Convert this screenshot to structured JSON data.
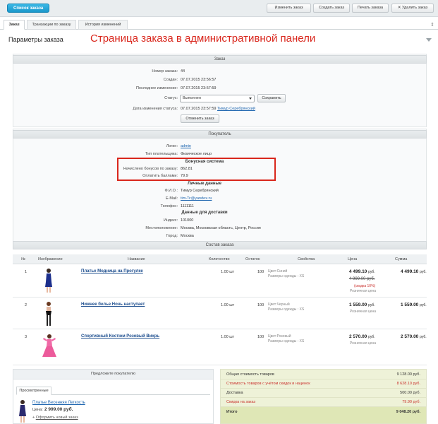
{
  "toolbar": {
    "order_list": "Список заказа",
    "edit": "Изменить заказ",
    "create": "Создать заказ",
    "print": "Печать заказа",
    "delete": "Удалить заказ"
  },
  "tabs": [
    "Заказ",
    "Транзакции по заказу",
    "История изменений"
  ],
  "header": {
    "title": "Параметры заказа",
    "caption": "Страница заказа в административной панели"
  },
  "order": {
    "bar": "Заказ",
    "number_label": "Номер заказа:",
    "number": "44",
    "created_label": "Создан:",
    "created": "07.07.2015 23:56:57",
    "modified_label": "Последнее изменение:",
    "modified": "07.07.2015 23:57:59",
    "status_label": "Статус:",
    "status_value": "Выполнен",
    "save": "Сохранить",
    "status_date_label": "Дата изменения статуса:",
    "status_date": "07.07.2015 23:57:59",
    "status_user": "Тимур Серебрянский",
    "cancel": "Отменить заказ"
  },
  "buyer": {
    "bar": "Покупатель",
    "login_label": "Логин:",
    "login": "admin",
    "payer_label": "Тип плательщика:",
    "payer": "Физическое лицо",
    "bonus_head": "Бонусная система",
    "bonus_label": "Начислено бонусов по заказу:",
    "bonus": "862.81",
    "paid_label": "Оплатить баллами:",
    "paid": "79.9",
    "personal_head": "Личные данные",
    "fio_label": "Ф.И.О.:",
    "fio": "Тимур Серебрянский",
    "email_label": "E-Mail:",
    "email": "tim-Tc@yandex.ru",
    "phone_label": "Телефон:",
    "phone": "1111111",
    "delivery_head": "Данные для доставки",
    "index_label": "Индекс:",
    "index": "101000",
    "location_label": "Местоположение:",
    "location": "Москва, Московская область, Центр, Россия",
    "city_label": "Город:",
    "city": "Москва"
  },
  "composition": {
    "bar": "Состав заказа",
    "columns": [
      "№",
      "Изображение",
      "Название",
      "Количество",
      "Остаток",
      "Свойства",
      "Цена",
      "Сумма"
    ],
    "items": [
      {
        "n": "1",
        "name": "Платье Модница на Прогулке",
        "qty": "1.00 шт",
        "stock": "100",
        "prop1": "Цвет:Синий",
        "prop2": "Размеры одежды : XS",
        "price": "4 499.10",
        "old": "4 999.00",
        "disc": "(скидка 10%)",
        "note": "Розничная цена",
        "sum": "4 499.10"
      },
      {
        "n": "2",
        "name": "Нижнее белье Ночь наступает",
        "qty": "1.00 шт",
        "stock": "100",
        "prop1": "Цвет:Черный",
        "prop2": "Размеры одежды : XS",
        "price": "1 559.00",
        "old": "",
        "disc": "",
        "note": "Розничная цена",
        "sum": "1 559.00"
      },
      {
        "n": "3",
        "name": "Спортивный Костюм Розовый Вихрь",
        "qty": "1.00 шт",
        "stock": "100",
        "prop1": "Цвет:Розовый",
        "prop2": "Размеры одежды : XS",
        "price": "2 570.00",
        "old": "",
        "disc": "",
        "note": "Розничная цена",
        "sum": "2 570.00"
      }
    ],
    "currency": "руб."
  },
  "recommend": {
    "title": "Предложите покупателю",
    "tab": "Просмотренные",
    "item_name": "Платье Весенняя Легкость",
    "price_label": "Цена:",
    "price": "2 999.00 руб.",
    "new_order": "Оформить новый заказ"
  },
  "totals": [
    {
      "label": "Общая стоимость товаров",
      "value": "9 128.00 руб.",
      "style": "normal"
    },
    {
      "label": "Стоимость товаров с учётом скидок и наценок",
      "value": "8 628.10 руб.",
      "style": "red"
    },
    {
      "label": "Доставка",
      "value": "500.00 руб.",
      "style": "normal"
    },
    {
      "label": "Скидка на заказ",
      "value": "79.90 руб.",
      "style": "red"
    },
    {
      "label": "Итого",
      "value": "9 048.20 руб.",
      "style": "total"
    }
  ],
  "colors": {
    "accent": "#1a97cb",
    "highlight": "#d9261c",
    "link": "#2067b0"
  }
}
